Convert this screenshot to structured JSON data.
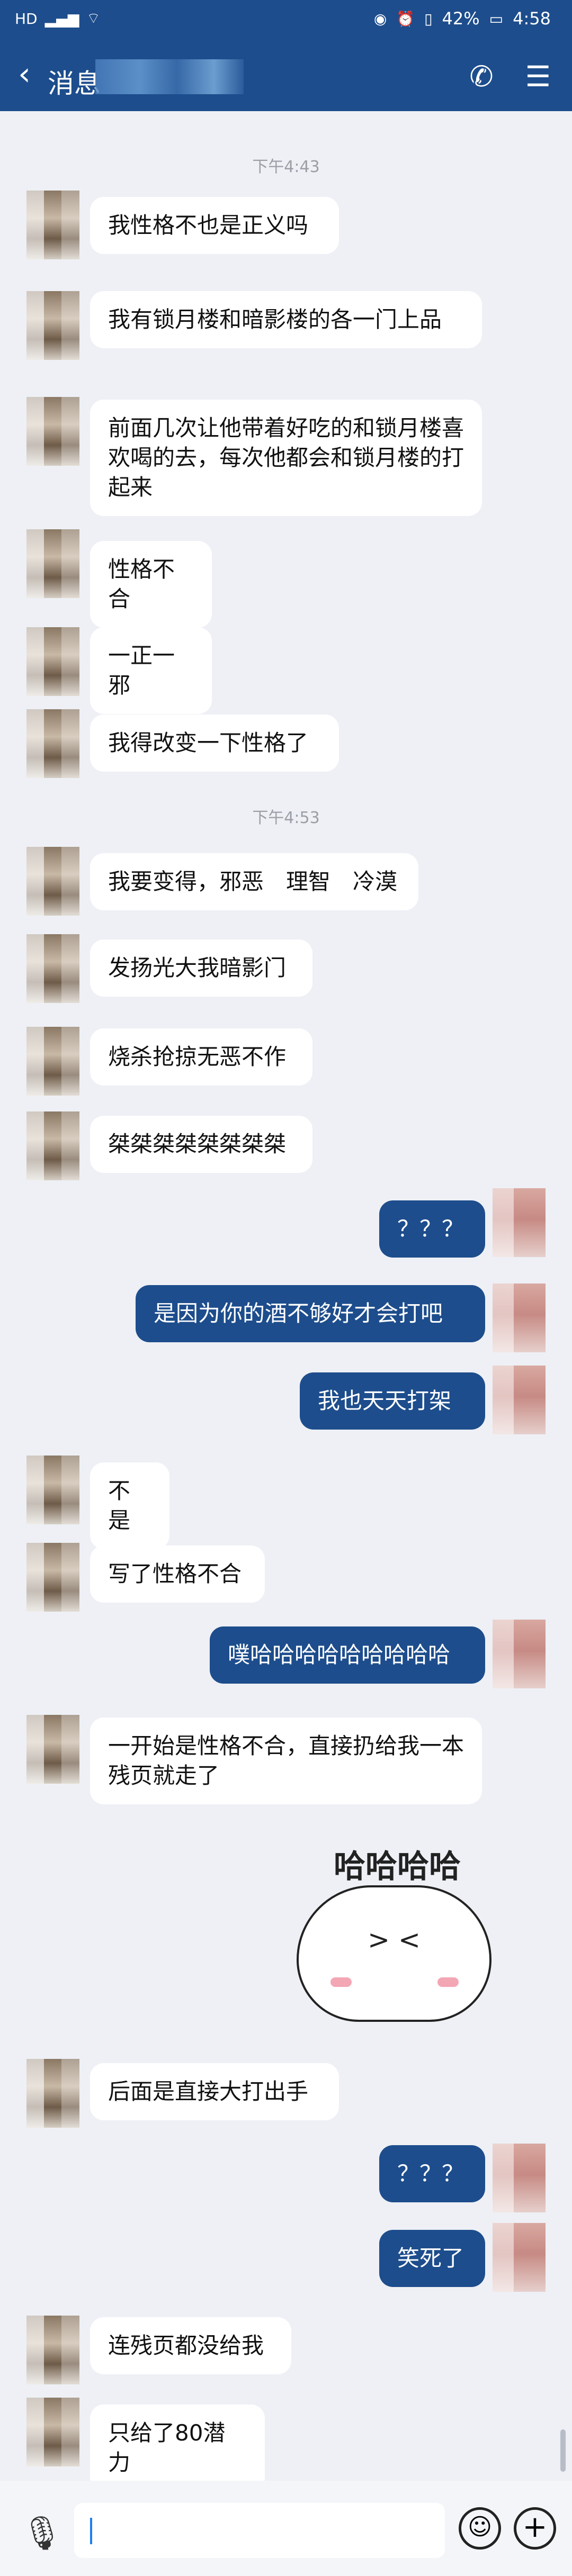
{
  "status_bar": {
    "left_icons": [
      "hd-icon",
      "signal-icon",
      "wifi-icon"
    ],
    "right_icons": [
      "eye-icon",
      "alarm-icon",
      "vibrate-icon"
    ],
    "battery": "42%",
    "time": "4:58"
  },
  "header": {
    "back_label": "消息",
    "phone_icon": "phone-icon",
    "menu_icon": "menu-icon"
  },
  "messages": [
    {
      "side": "left",
      "text": "我性格不也是正义吗"
    },
    {
      "side": "left",
      "text": "我有锁月楼和暗影楼的各一门上品"
    },
    {
      "side": "left",
      "text": "前面几次让他带着好吃的和锁月楼喜欢喝的去，每次他都会和锁月楼的打起来"
    },
    {
      "side": "left",
      "text": "性格不合"
    },
    {
      "side": "left",
      "text": "一正一邪"
    },
    {
      "side": "left",
      "text": "我得改变一下性格了"
    },
    {
      "side": "left",
      "text": "我要变得，邪恶　理智　冷漠"
    },
    {
      "side": "left",
      "text": "发扬光大我暗影门"
    },
    {
      "side": "left",
      "text": "烧杀抢掠无恶不作"
    },
    {
      "side": "left",
      "text": "桀桀桀桀桀桀桀桀"
    },
    {
      "side": "right",
      "text": "？？？"
    },
    {
      "side": "right",
      "text": "是因为你的酒不够好才会打吧"
    },
    {
      "side": "right",
      "text": "我也天天打架"
    },
    {
      "side": "left",
      "text": "不是"
    },
    {
      "side": "left",
      "text": "写了性格不合"
    },
    {
      "side": "right",
      "text": "噗哈哈哈哈哈哈哈哈哈"
    },
    {
      "side": "left",
      "text": "一开始是性格不合，直接扔给我一本残页就走了"
    },
    {
      "side": "left",
      "text": "后面是直接大打出手"
    },
    {
      "side": "right",
      "text": "？？？"
    },
    {
      "side": "right",
      "text": "笑死了"
    },
    {
      "side": "left",
      "text": "连残页都没给我"
    },
    {
      "side": "left",
      "text": "只给了80潜力"
    }
  ],
  "timestamps": [
    "下午4:43",
    "下午4:53"
  ],
  "sticker": {
    "text": "哈哈哈哈",
    "face": "> <",
    "icon": "laughing-bun-sticker"
  },
  "input_bar": {
    "mic_icon": "microphone-icon",
    "placeholder": "",
    "emoji_icon": "emoji-icon",
    "plus_icon": "plus-icon"
  }
}
